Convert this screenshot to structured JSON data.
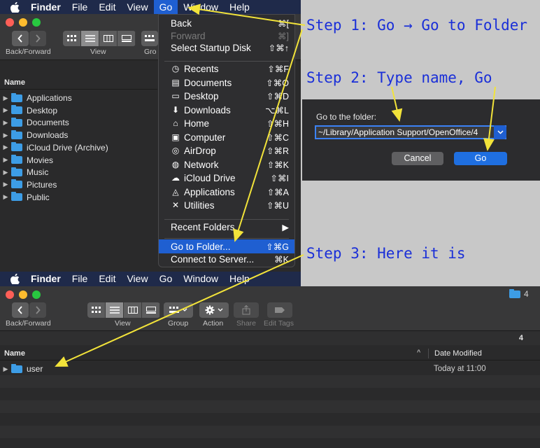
{
  "top_menubar": {
    "items": [
      "Finder",
      "File",
      "Edit",
      "View",
      "Go",
      "Window",
      "Help"
    ],
    "active": "Go"
  },
  "top_toolbar": {
    "back_forward_label": "Back/Forward",
    "view_label": "View",
    "group_label_partial": "Gro"
  },
  "top_sidebar": {
    "column_header": "Name",
    "items": [
      "Applications",
      "Desktop",
      "Documents",
      "Downloads",
      "iCloud Drive (Archive)",
      "Movies",
      "Music",
      "Pictures",
      "Public"
    ]
  },
  "go_menu": {
    "items": [
      {
        "label": "Back",
        "shortcut": "⌘[",
        "disabled": false,
        "icon": ""
      },
      {
        "label": "Forward",
        "shortcut": "⌘]",
        "disabled": true,
        "icon": ""
      },
      {
        "label": "Select Startup Disk",
        "shortcut": "⇧⌘↑",
        "disabled": false,
        "icon": ""
      },
      {
        "label": "Recents",
        "shortcut": "⇧⌘F",
        "disabled": false,
        "icon": "recents-icon"
      },
      {
        "label": "Documents",
        "shortcut": "⇧⌘O",
        "disabled": false,
        "icon": "documents-icon"
      },
      {
        "label": "Desktop",
        "shortcut": "⇧⌘D",
        "disabled": false,
        "icon": "desktop-icon"
      },
      {
        "label": "Downloads",
        "shortcut": "⌥⌘L",
        "disabled": false,
        "icon": "downloads-icon"
      },
      {
        "label": "Home",
        "shortcut": "⇧⌘H",
        "disabled": false,
        "icon": "home-icon"
      },
      {
        "label": "Computer",
        "shortcut": "⇧⌘C",
        "disabled": false,
        "icon": "computer-icon"
      },
      {
        "label": "AirDrop",
        "shortcut": "⇧⌘R",
        "disabled": false,
        "icon": "airdrop-icon"
      },
      {
        "label": "Network",
        "shortcut": "⇧⌘K",
        "disabled": false,
        "icon": "network-icon"
      },
      {
        "label": "iCloud Drive",
        "shortcut": "⇧⌘I",
        "disabled": false,
        "icon": "icloud-icon"
      },
      {
        "label": "Applications",
        "shortcut": "⇧⌘A",
        "disabled": false,
        "icon": "applications-icon"
      },
      {
        "label": "Utilities",
        "shortcut": "⇧⌘U",
        "disabled": false,
        "icon": "utilities-icon"
      },
      {
        "label": "Recent Folders",
        "shortcut": "▶",
        "disabled": false,
        "icon": ""
      },
      {
        "label": "Go to Folder...",
        "shortcut": "⇧⌘G",
        "disabled": false,
        "icon": "",
        "selected": true
      },
      {
        "label": "Connect to Server...",
        "shortcut": "⌘K",
        "disabled": false,
        "icon": ""
      }
    ]
  },
  "annotations": {
    "step1": "Step 1: Go → Go to Folder",
    "step2": "Step 2: Type name, Go",
    "step3": "Step 3: Here it is"
  },
  "dialog": {
    "label": "Go to the folder:",
    "path_value": "~/Library/Application Support/OpenOffice/4",
    "cancel_label": "Cancel",
    "go_label": "Go"
  },
  "bottom_menubar": {
    "items": [
      "Finder",
      "File",
      "Edit",
      "View",
      "Go",
      "Window",
      "Help"
    ]
  },
  "bottom_window": {
    "title": "4",
    "toolbar_labels": {
      "back_forward": "Back/Forward",
      "view": "View",
      "group": "Group",
      "action": "Action",
      "share": "Share",
      "edit_tags": "Edit Tags"
    },
    "path_label": "4",
    "columns": {
      "name": "Name",
      "date_modified": "Date Modified"
    },
    "rows": [
      {
        "name": "user",
        "date_modified": "Today at 11:00"
      }
    ]
  },
  "colors": {
    "menubar_bg": "#1f2a4a",
    "selection_blue": "#1f5fd1",
    "annotation_text": "#1a2fd8",
    "arrow_yellow": "#f2e33a",
    "folder_blue": "#3d9de6"
  }
}
